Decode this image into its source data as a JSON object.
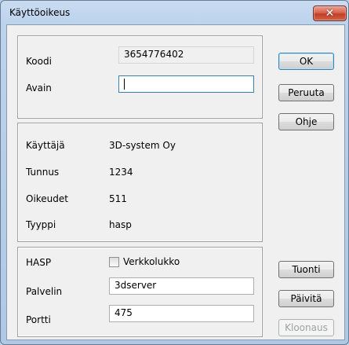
{
  "window": {
    "title": "Käyttöoikeus",
    "close_glyph": "✕"
  },
  "license": {
    "koodi_label": "Koodi",
    "koodi_value": "3654776402",
    "avain_label": "Avain",
    "avain_value": ""
  },
  "info": {
    "kayttaja_label": "Käyttäjä",
    "kayttaja_value": "3D-system Oy",
    "tunnus_label": "Tunnus",
    "tunnus_value": "1234",
    "oikeudet_label": "Oikeudet",
    "oikeudet_value": "511",
    "tyyppi_label": "Tyyppi",
    "tyyppi_value": "hasp"
  },
  "hasp": {
    "hasp_label": "HASP",
    "verkkolukko_label": "Verkkolukko",
    "verkkolukko_checked": false,
    "palvelin_label": "Palvelin",
    "palvelin_value": "3dserver",
    "portti_label": "Portti",
    "portti_value": "475"
  },
  "buttons": {
    "ok": "OK",
    "peruuta": "Peruuta",
    "ohje": "Ohje",
    "tuonti": "Tuonti",
    "paivita": "Päivitä",
    "kloonaus": "Kloonaus"
  },
  "colors": {
    "titlebar": "#bcd3ec",
    "close_button": "#c13f25",
    "client_bg": "#f0f0f0"
  }
}
